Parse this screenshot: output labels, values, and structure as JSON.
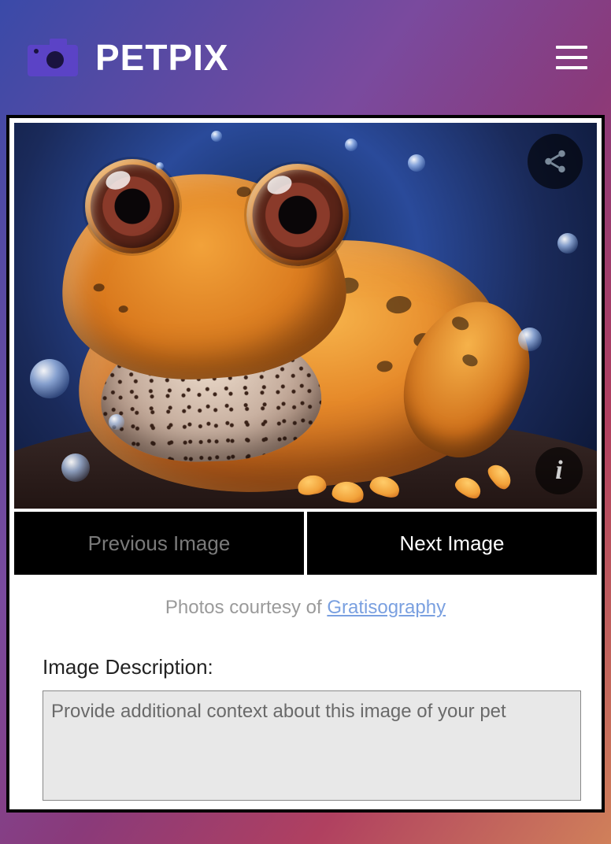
{
  "header": {
    "brand": "PETPIX"
  },
  "nav": {
    "prev_label": "Previous Image",
    "next_label": "Next Image"
  },
  "credit": {
    "prefix": "Photos courtesy of ",
    "link_text": "Gratisography"
  },
  "description": {
    "label": "Image Description:",
    "placeholder": "Provide additional context about this image of your pet",
    "value": ""
  }
}
